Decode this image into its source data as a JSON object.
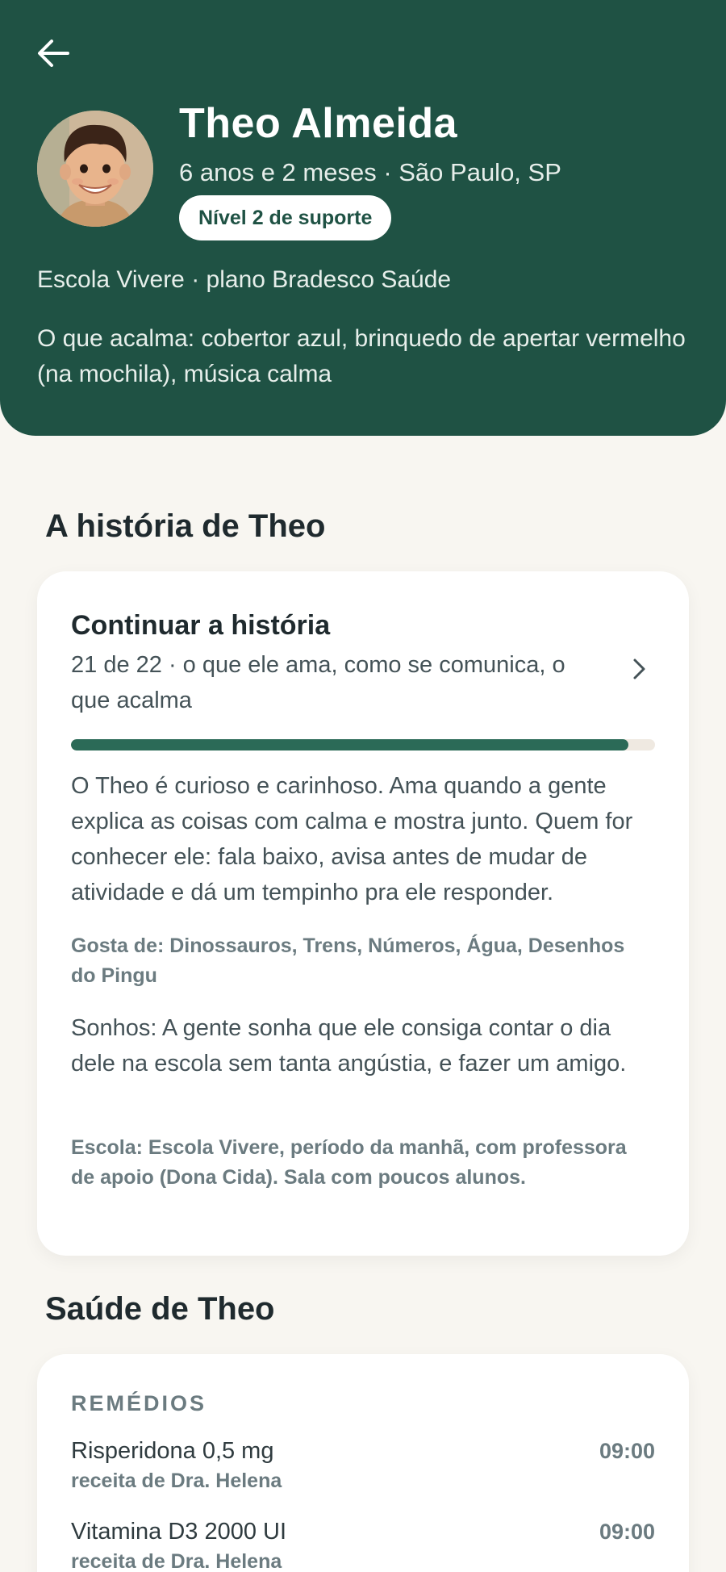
{
  "profile": {
    "name": "Theo Almeida",
    "meta": "6 anos e 2 meses · São Paulo, SP",
    "badge": "Nível 2 de suporte",
    "school_plan": "Escola Vivere · plano Bradesco Saúde",
    "calming": "O que acalma: cobertor azul, brinquedo de apertar vermelho (na mochila), música calma"
  },
  "story": {
    "section_title": "A história de Theo",
    "card_title": "Continuar a história",
    "card_subtitle": "21 de 22 · o que ele ama, como se comunica, o que acalma",
    "progress_fraction": 0.9545,
    "body": "O Theo é curioso e carinhoso. Ama quando a gente explica as coisas com calma e mostra junto. Quem for conhecer ele: fala baixo, avisa antes de mudar de atividade e dá um tempinho pra ele responder.",
    "likes": "Gosta de: Dinossauros, Trens, Números, Água, Desenhos do Pingu",
    "dreams": "Sonhos: A gente sonha que ele consiga contar o dia dele na escola sem tanta angústia, e fazer um amigo.",
    "school": "Escola: Escola Vivere, período da manhã, com professora de apoio (Dona Cida). Sala com poucos alunos."
  },
  "health": {
    "section_title": "Saúde de Theo",
    "meds_label": "REMÉDIOS",
    "meds": [
      {
        "name": "Risperidona 0,5 mg",
        "note": "receita de Dra. Helena",
        "time": "09:00"
      },
      {
        "name": "Vitamina D3 2000 UI",
        "note": "receita de Dra. Helena",
        "time": "09:00"
      }
    ]
  },
  "colors": {
    "header_bg": "#1f5244",
    "progress": "#2b6a57",
    "page_bg": "#f8f6f1"
  },
  "icons": {
    "back": "arrow-left-icon",
    "chevron": "chevron-right-icon"
  }
}
